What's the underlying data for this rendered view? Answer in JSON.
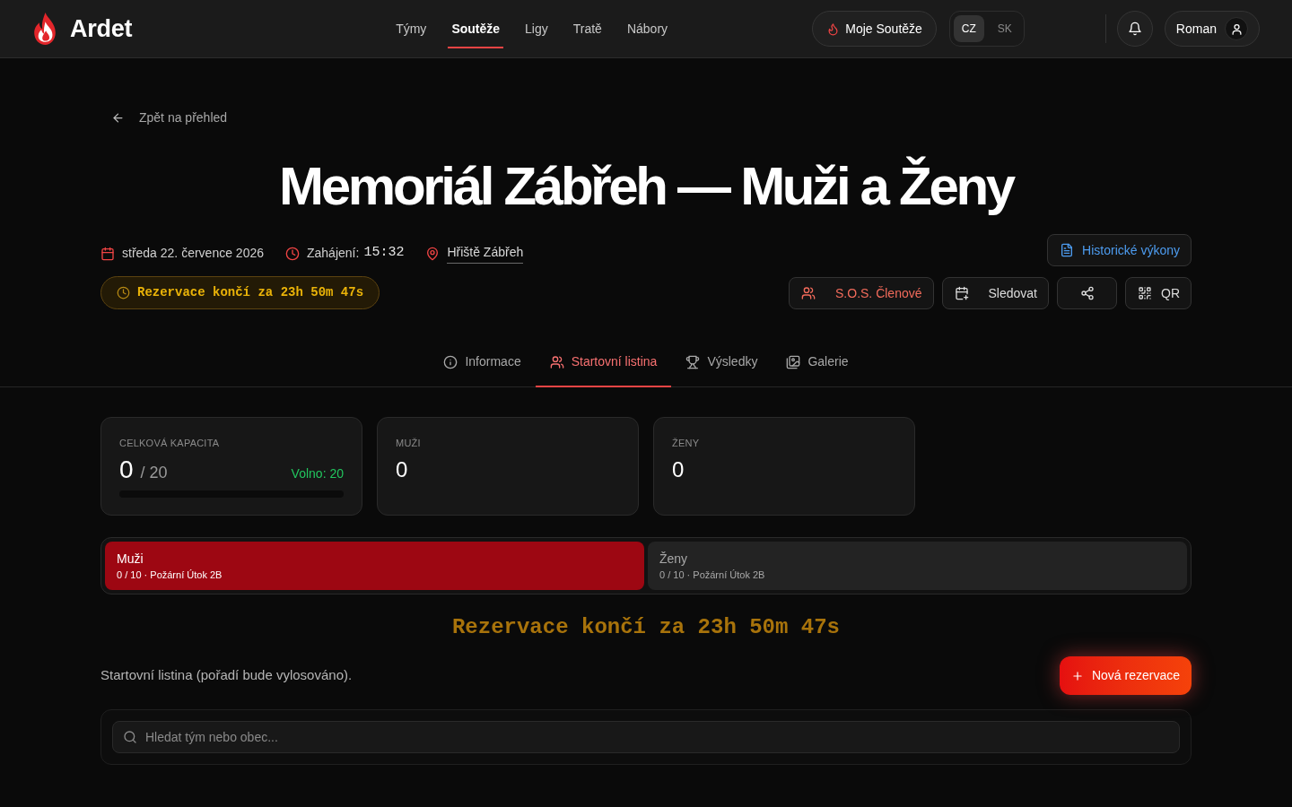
{
  "header": {
    "logo": "Ardet",
    "nav": [
      {
        "label": "Týmy",
        "selected": false
      },
      {
        "label": "Soutěže",
        "selected": true
      },
      {
        "label": "Ligy",
        "selected": false
      },
      {
        "label": "Tratě",
        "selected": false
      },
      {
        "label": "Nábory",
        "selected": false
      }
    ],
    "my_competitions": "Moje Soutěže",
    "languages": [
      {
        "label": "CZ",
        "selected": true
      },
      {
        "label": "SK",
        "selected": false
      }
    ],
    "user": "Roman"
  },
  "back_link": "Zpět na přehled",
  "title": "Memoriál Zábřeh — Muži a Ženy",
  "meta": {
    "date": "středa 22. července 2026",
    "start_label": "Zahájení:",
    "start_time": "15:32",
    "location": "Hřiště Zábřeh"
  },
  "countdown_pill": "Rezervace končí za 23h 50m 47s",
  "history_button": "Historické výkony",
  "actions": [
    {
      "kind": "sos",
      "label": "S.O.S. Členové"
    },
    {
      "kind": "follow",
      "label": "Sledovat"
    },
    {
      "kind": "share"
    },
    {
      "kind": "qr",
      "label": "QR"
    }
  ],
  "tabs": [
    {
      "kind": "info",
      "label": "Informace",
      "selected": false
    },
    {
      "kind": "start_list",
      "label": "Startovní listina",
      "selected": true
    },
    {
      "kind": "results",
      "label": "Výsledky",
      "selected": false
    },
    {
      "kind": "gallery",
      "label": "Galerie",
      "selected": false
    }
  ],
  "stats": [
    {
      "kind": "capacity",
      "label": "CELKOVÁ KAPACITA",
      "value": "0",
      "total": "/ 20",
      "free": "Volno: 20",
      "level": 0
    },
    {
      "kind": "count",
      "label": "MUŽI",
      "value": "0"
    },
    {
      "kind": "count",
      "label": "ŽENY",
      "value": "0"
    }
  ],
  "categories": [
    {
      "name": "Muži",
      "detail": "0 / 10 · Požární Útok 2B",
      "selected": true
    },
    {
      "name": "Ženy",
      "detail": "0 / 10 · Požární Útok 2B",
      "selected": false
    }
  ],
  "countdown_banner": "Rezervace končí za 23h 50m 47s",
  "start_list": {
    "note": "Startovní listina (pořadí bude vylosováno).",
    "new_reservation": "Nová rezervace",
    "search": {
      "placeholder": "Hledat tým nebo obec..."
    }
  }
}
